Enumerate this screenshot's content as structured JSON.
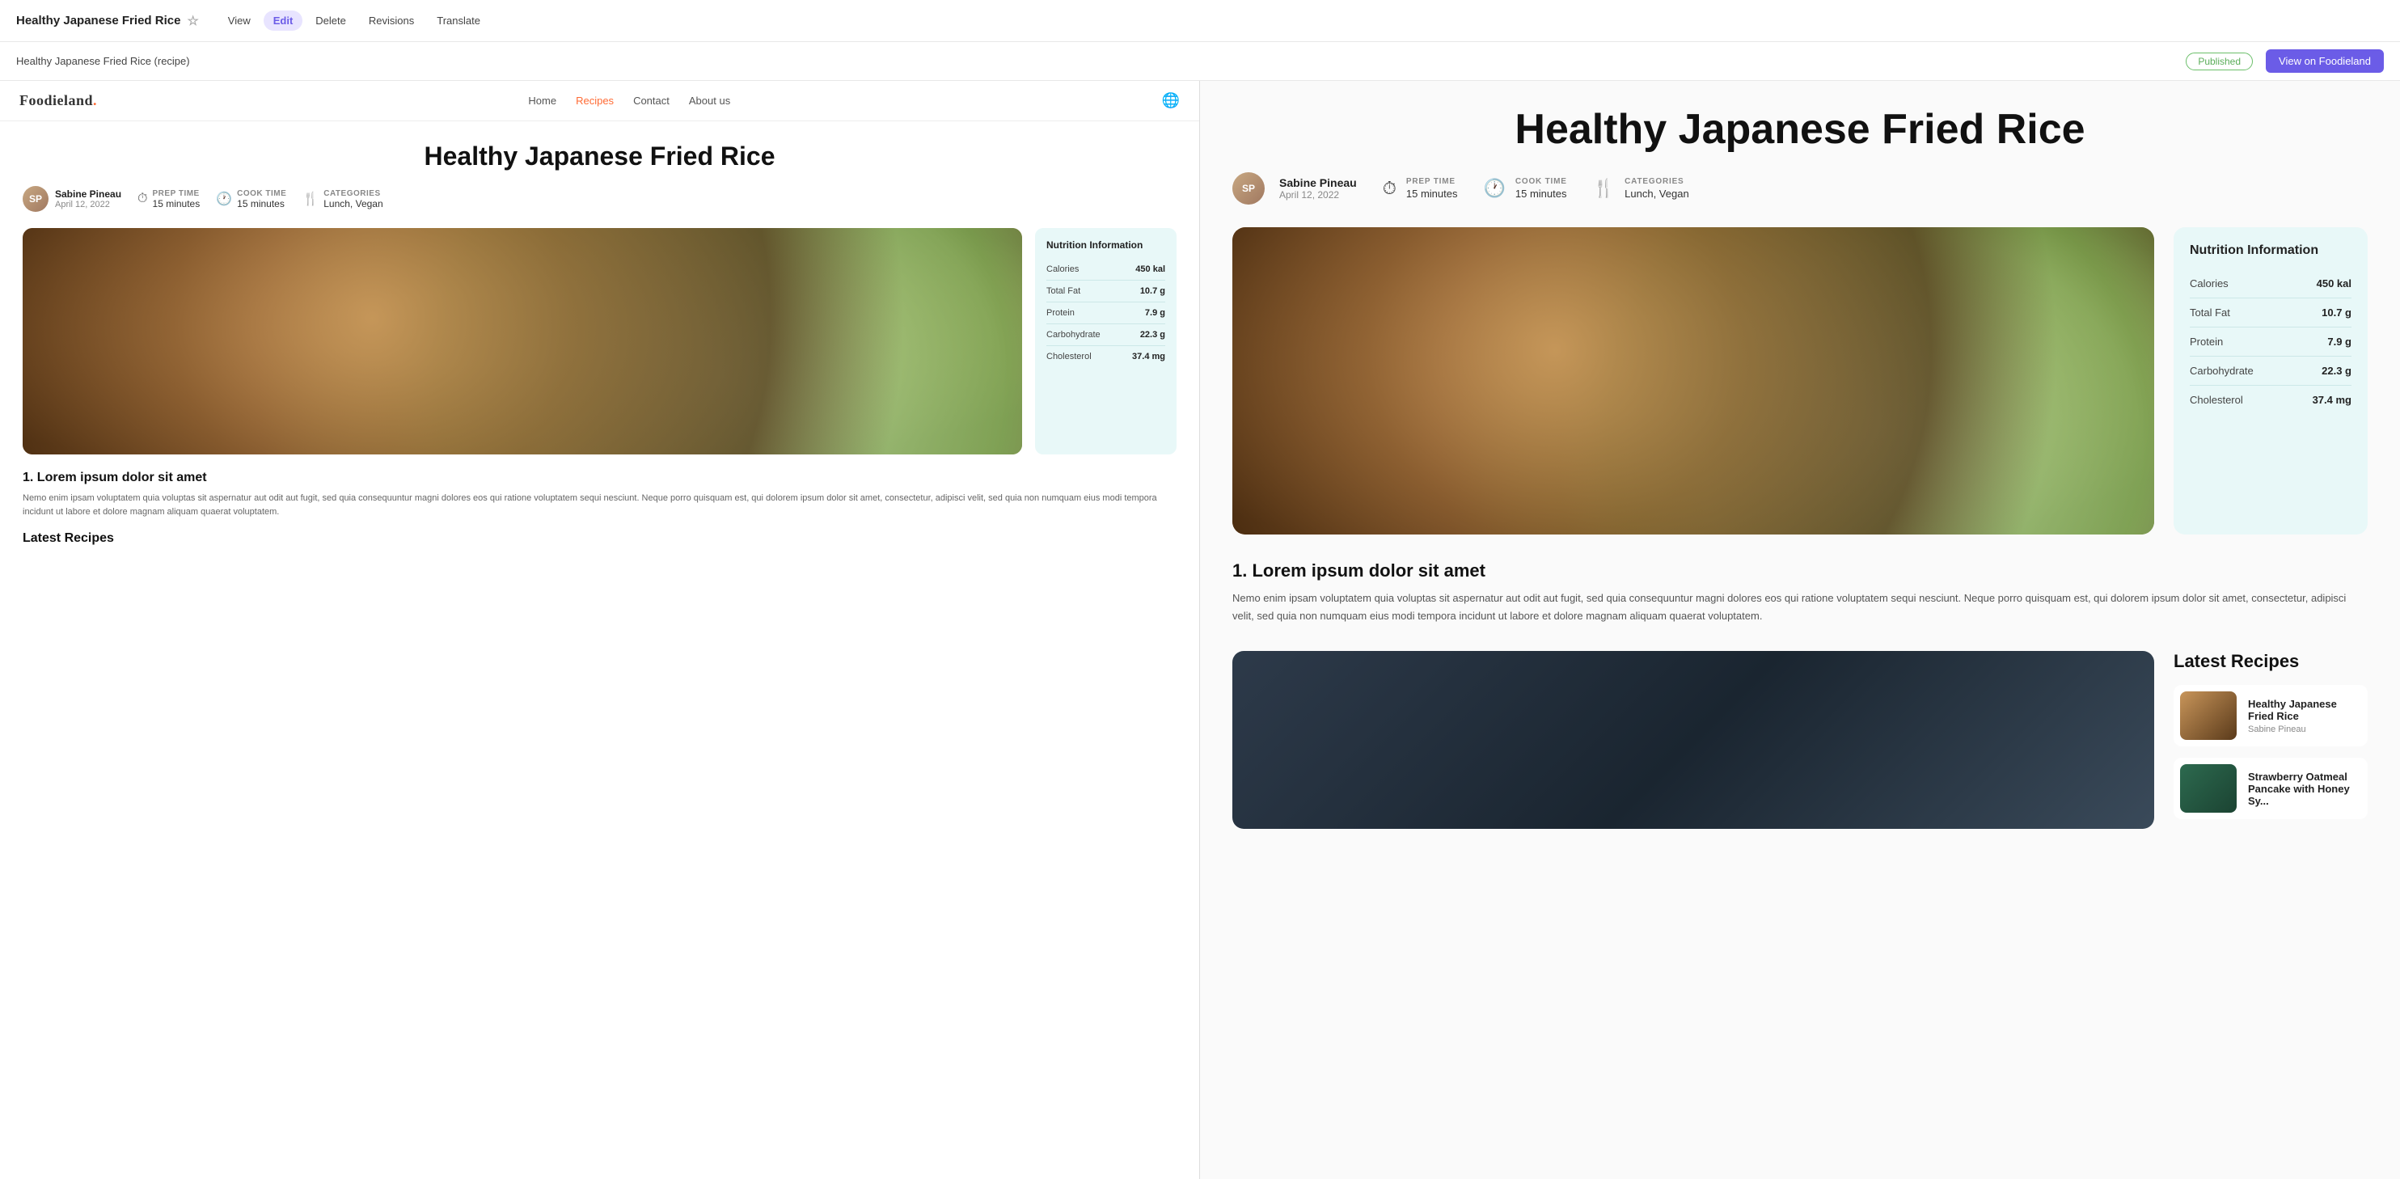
{
  "topbar": {
    "title": "Healthy Japanese Fried Rice",
    "star": "☆",
    "buttons": [
      {
        "id": "view",
        "label": "View",
        "active": false
      },
      {
        "id": "edit",
        "label": "Edit",
        "active": true
      },
      {
        "id": "delete",
        "label": "Delete",
        "active": false
      },
      {
        "id": "revisions",
        "label": "Revisions",
        "active": false
      },
      {
        "id": "translate",
        "label": "Translate",
        "active": false
      }
    ]
  },
  "contentbar": {
    "title": "Healthy Japanese Fried Rice (recipe)",
    "status": "Published",
    "viewButton": "View on Foodieland"
  },
  "preview": {
    "logo": "Foodieland.",
    "nav": [
      {
        "label": "Home",
        "active": false
      },
      {
        "label": "Recipes",
        "active": true
      },
      {
        "label": "Contact",
        "active": false
      },
      {
        "label": "About us",
        "active": false
      }
    ],
    "article": {
      "title": "Healthy Japanese Fried Rice",
      "author": {
        "name": "Sabine Pineau",
        "date": "April 12, 2022",
        "initials": "SP"
      },
      "meta": [
        {
          "label": "PREP TIME",
          "value": "15 minutes",
          "icon": "⏱"
        },
        {
          "label": "COOK TIME",
          "value": "15 minutes",
          "icon": "🕐"
        },
        {
          "label": "CATEGORIES",
          "value": "Lunch, Vegan",
          "icon": "🍴"
        }
      ],
      "nutrition": {
        "title": "Nutrition Information",
        "items": [
          {
            "label": "Calories",
            "value": "450 kal"
          },
          {
            "label": "Total Fat",
            "value": "10.7 g"
          },
          {
            "label": "Protein",
            "value": "7.9 g"
          },
          {
            "label": "Carbohydrate",
            "value": "22.3 g"
          },
          {
            "label": "Cholesterol",
            "value": "37.4 mg"
          }
        ]
      },
      "section1": {
        "heading": "1. Lorem ipsum dolor sit amet",
        "text": "Nemo enim ipsam voluptatem quia voluptas sit aspernatur aut odit aut fugit, sed quia consequuntur magni dolores eos qui ratione voluptatem sequi nesciunt. Neque porro quisquam est, qui dolorem ipsum dolor sit amet, consectetur, adipisci velit, sed quia non numquam eius modi tempora incidunt ut labore et dolore magnam aliquam quaerat voluptatem."
      },
      "latestRecipes": {
        "title": "Latest Recipes",
        "items": [
          {
            "title": "Healthy Japanese Fried Rice",
            "author": "Sabine Pineau"
          },
          {
            "title": "Strawberry Oatmeal Pancake with Honey Sy...",
            "author": ""
          }
        ]
      }
    }
  }
}
